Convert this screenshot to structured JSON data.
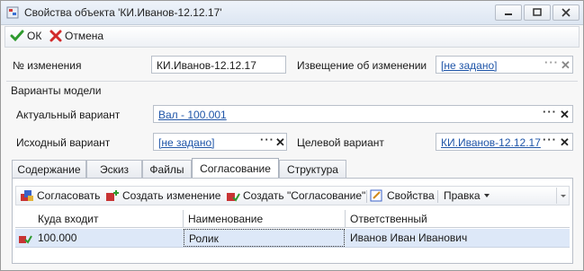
{
  "window": {
    "title": "Свойства объекта 'КИ.Иванов-12.12.17'"
  },
  "toolbar": {
    "ok_label": "ОК",
    "cancel_label": "Отмена"
  },
  "form": {
    "change_number_label": "№ изменения",
    "change_number_value": "КИ.Иванов-12.12.17",
    "notice_label": "Извещение об изменении",
    "notice_value": "[не задано]",
    "group_title": "Варианты модели",
    "actual_label": "Актуальный вариант",
    "actual_value": "Вал - 100.001",
    "source_label": "Исходный вариант",
    "source_value": "[не задано]",
    "target_label": "Целевой вариант",
    "target_value": "КИ.Иванов-12.12.17"
  },
  "tabs": [
    "Содержание",
    "Эскиз",
    "Файлы",
    "Согласование",
    "Структура"
  ],
  "active_tab": "Согласование",
  "panel_toolbar": {
    "approve": "Согласовать",
    "create_change": "Создать изменение",
    "create_approval": "Создать \"Согласование\"",
    "properties": "Свойства",
    "edit": "Правка"
  },
  "table": {
    "columns": [
      "Куда входит",
      "Наименование",
      "Ответственный"
    ],
    "rows": [
      {
        "where": "100.000",
        "name": "Ролик",
        "responsible": "Иванов Иван Иванович"
      }
    ]
  }
}
